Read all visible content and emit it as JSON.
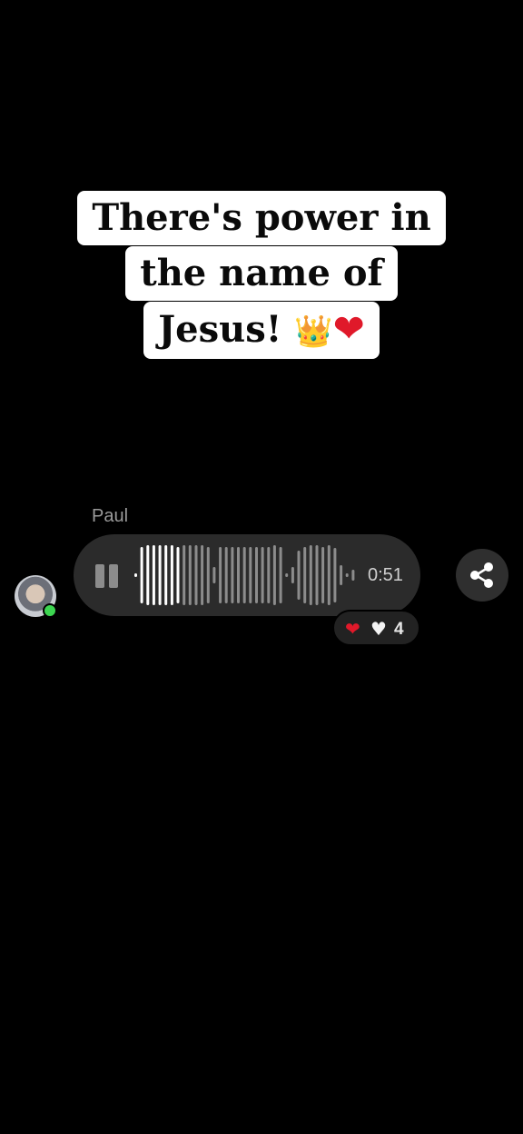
{
  "caption": {
    "line1": "There's power in",
    "line2": "the name of",
    "line3_text": "Jesus! ",
    "line3_crown": "👑",
    "line3_heart": "❤",
    "icons": [
      "crown-icon",
      "heart-icon"
    ]
  },
  "message": {
    "sender": "Paul",
    "duration": "0:51",
    "state": "playing",
    "status_color": "#3dd651",
    "bubble_color": "#2b2b2b"
  },
  "reactions": {
    "heart_red": "❤",
    "heart_white": "♥",
    "count": "4"
  },
  "actions": {
    "share_icon": "share-icon",
    "pause_icon": "pause-icon"
  },
  "colors": {
    "background": "#000000",
    "caption_bg": "#ffffff",
    "heart": "#e0192a",
    "played_wave": "#ffffff",
    "unplayed_wave": "#8c8c8c"
  }
}
